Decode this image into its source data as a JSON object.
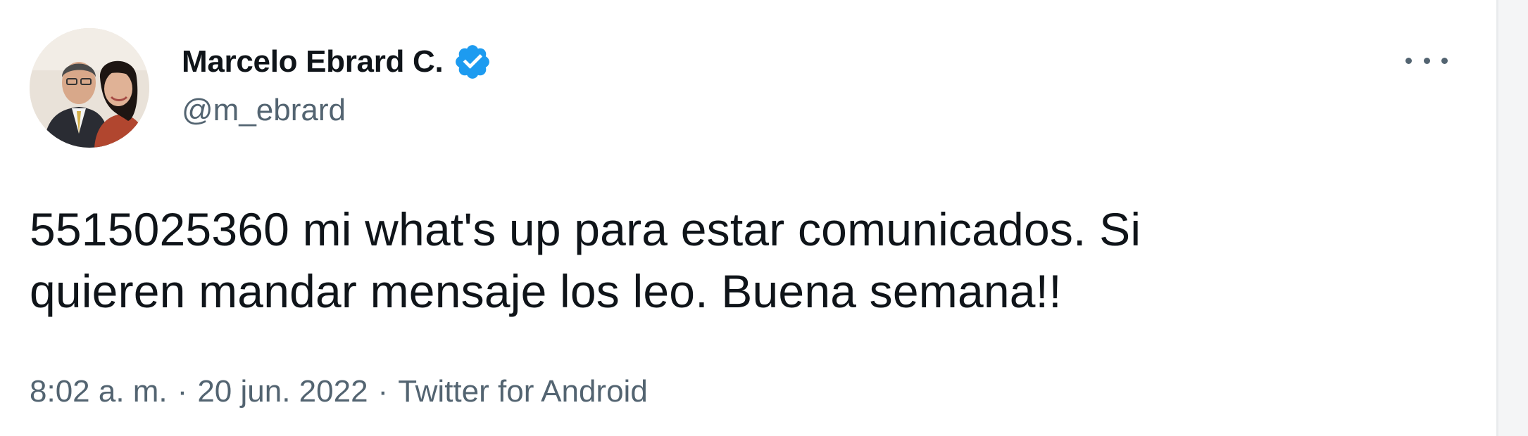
{
  "tweet": {
    "author": {
      "display_name": "Marcelo Ebrard C.",
      "handle": "@m_ebrard",
      "verified": true,
      "avatar_icon": "profile-photo",
      "verified_icon": "verified-badge-icon"
    },
    "text_lines": [
      "5515025360 mi what's up para estar comunicados. Si",
      "quieren mandar mensaje los leo. Buena semana!!"
    ],
    "meta": {
      "time": "8:02 a. m.",
      "separator": "·",
      "date": "20 jun. 2022",
      "source": "Twitter for Android"
    },
    "more_icon": "more-horizontal-icon"
  },
  "colors": {
    "text_primary": "#0f1419",
    "text_secondary": "#536471",
    "verified_blue": "#1d9bf0",
    "background": "#ffffff"
  }
}
